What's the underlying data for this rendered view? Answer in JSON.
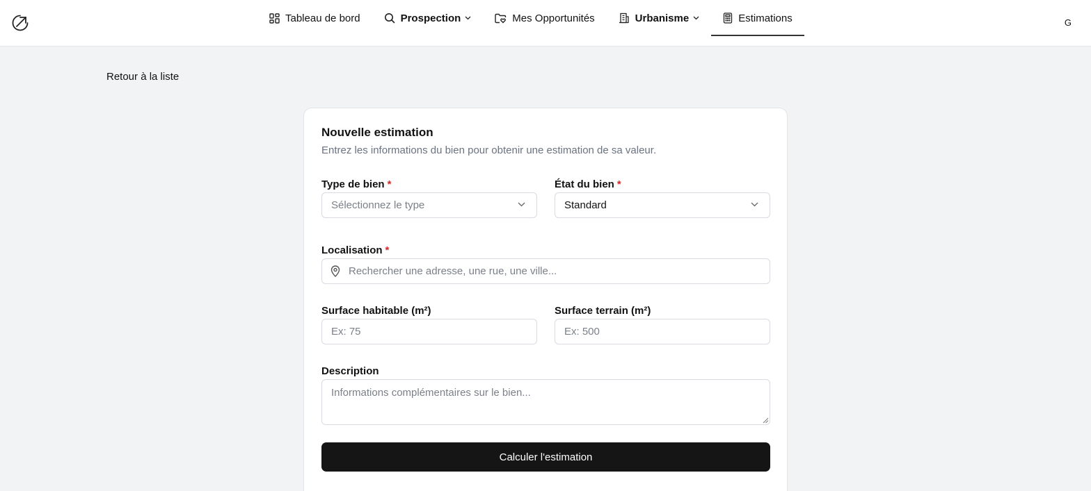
{
  "nav": {
    "items": [
      {
        "label": "Tableau de bord",
        "icon": "dashboard-icon"
      },
      {
        "label": "Prospection",
        "icon": "search-icon",
        "dropdown": true
      },
      {
        "label": "Mes Opportunités",
        "icon": "folder-heart-icon"
      },
      {
        "label": "Urbanisme",
        "icon": "building-icon",
        "dropdown": true
      },
      {
        "label": "Estimations",
        "icon": "calculator-icon",
        "active": true
      }
    ],
    "user_initial": "G"
  },
  "back_label": "Retour à la liste",
  "form": {
    "title": "Nouvelle estimation",
    "subtitle": "Entrez les informations du bien pour obtenir une estimation de sa valeur.",
    "type_label": "Type de bien",
    "type_placeholder": "Sélectionnez le type",
    "state_label": "État du bien",
    "state_value": "Standard",
    "required_mark": "*",
    "location_label": "Localisation",
    "location_placeholder": "Rechercher une adresse, une rue, une ville...",
    "living_area_label": "Surface habitable (m²)",
    "living_area_placeholder": "Ex: 75",
    "land_area_label": "Surface terrain (m²)",
    "land_area_placeholder": "Ex: 500",
    "description_label": "Description",
    "description_placeholder": "Informations complémentaires sur le bien...",
    "submit_label": "Calculer l'estimation"
  },
  "colors": {
    "background": "#f2f3f5",
    "button": "#151515",
    "required": "#dc2626",
    "muted_text": "#6b7280"
  }
}
